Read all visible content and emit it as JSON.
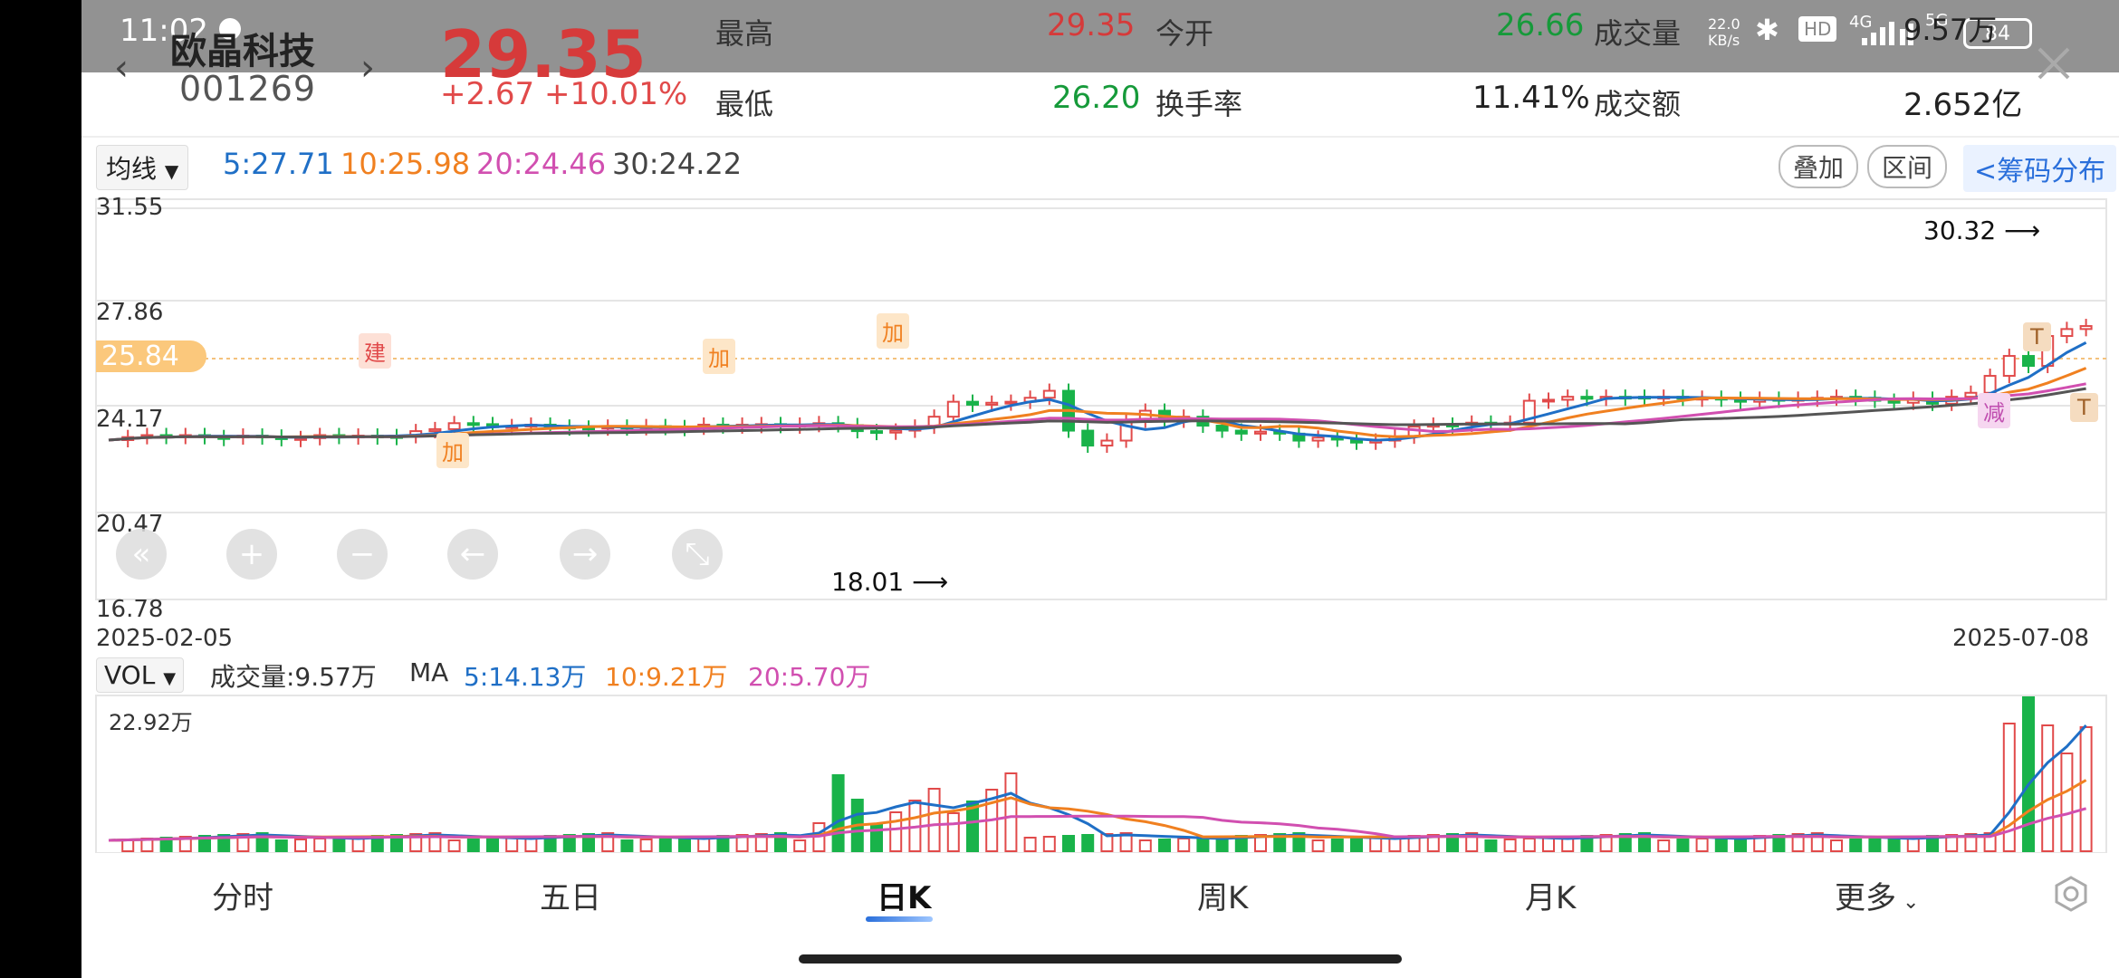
{
  "status_bar": {
    "time": "11:02",
    "net_speed_top": "22.0",
    "net_speed_bottom": "KB/s",
    "hd": "HD",
    "signal": "4G",
    "signal2": "5G",
    "battery": "84"
  },
  "stock": {
    "name": "欧晶科技",
    "code": "001269",
    "price": "29.35",
    "change": "+2.67",
    "change_pct": "+10.01%"
  },
  "quote": {
    "high_label": "最高",
    "high": "29.35",
    "open_label": "今开",
    "open": "26.66",
    "volume_label": "成交量",
    "volume": "9.57万",
    "low_label": "最低",
    "low": "26.20",
    "turnover_label": "换手率",
    "turnover": "11.41%",
    "amount_label": "成交额",
    "amount": "2.652亿"
  },
  "ma_bar": {
    "dropdown": "均线",
    "ma5": "5:27.71",
    "ma10": "10:25.98",
    "ma20": "20:24.46",
    "ma30": "30:24.22"
  },
  "right_buttons": {
    "overlay": "叠加",
    "range": "区间",
    "chips": "<筹码分布"
  },
  "price_chart": {
    "y_labels": [
      "31.55",
      "27.86",
      "24.17",
      "20.47",
      "16.78"
    ],
    "current_price_tag": "25.84",
    "date_start": "2025-02-05",
    "date_end": "2025-07-08",
    "max_marker": "30.32",
    "min_marker": "18.01",
    "signals": [
      {
        "text": "建",
        "kind": "build"
      },
      {
        "text": "加",
        "kind": "add"
      },
      {
        "text": "加",
        "kind": "add"
      },
      {
        "text": "加",
        "kind": "add"
      },
      {
        "text": "T",
        "kind": "t"
      },
      {
        "text": "T",
        "kind": "t"
      },
      {
        "text": "减",
        "kind": "reduce"
      }
    ]
  },
  "vol_bar": {
    "dropdown": "VOL",
    "volume": "成交量:9.57万",
    "ma_label": "MA",
    "ma5": "5:14.13万",
    "ma10": "10:9.21万",
    "ma20": "20:5.70万",
    "y_max": "22.92万"
  },
  "tabs": [
    "分时",
    "五日",
    "日K",
    "周K",
    "月K",
    "更多"
  ],
  "colors": {
    "up": "#e14a4a",
    "down": "#19b34a",
    "ma5": "#1f6fc6",
    "ma10": "#f08020",
    "ma20": "#d14fb0",
    "ma30": "#555555"
  }
}
